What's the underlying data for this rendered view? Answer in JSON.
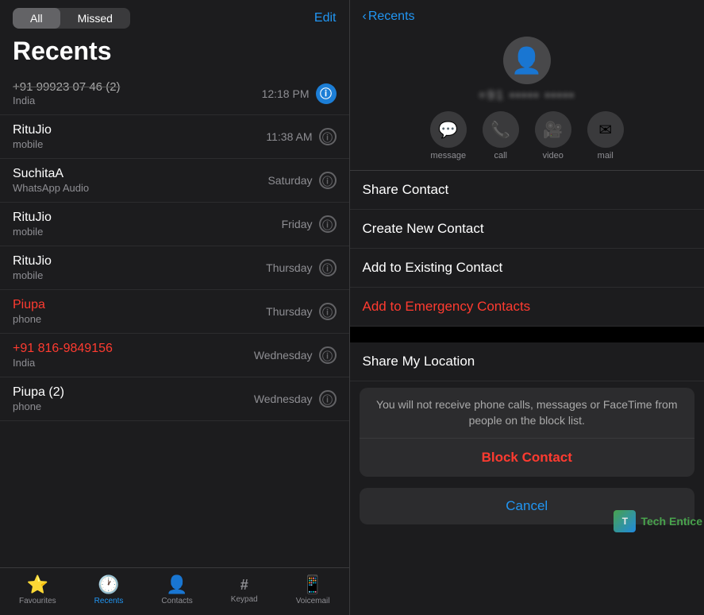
{
  "left": {
    "tabs": {
      "all": "All",
      "missed": "Missed"
    },
    "edit_label": "Edit",
    "title": "Recents",
    "calls": [
      {
        "name": "+91 99923 07 46 (2)",
        "sub": "India",
        "time": "12:18 PM",
        "blurred": true,
        "highlighted": true,
        "info_blue": true
      },
      {
        "name": "RituJio",
        "sub": "mobile",
        "time": "11:38 AM",
        "blurred": false,
        "highlighted": false,
        "info_blue": false
      },
      {
        "name": "SuchitaA",
        "sub": "WhatsApp Audio",
        "time": "Saturday",
        "blurred": false,
        "highlighted": false,
        "info_blue": false
      },
      {
        "name": "RituJio",
        "sub": "mobile",
        "time": "Friday",
        "blurred": false,
        "highlighted": false,
        "info_blue": false
      },
      {
        "name": "RituJio",
        "sub": "mobile",
        "time": "Thursday",
        "blurred": false,
        "highlighted": false,
        "info_blue": false
      },
      {
        "name": "Piupa",
        "sub": "phone",
        "time": "Thursday",
        "blurred": false,
        "highlighted": false,
        "info_blue": false,
        "red_name": true
      },
      {
        "name": "+91 816-9849156",
        "sub": "India",
        "time": "Wednesday",
        "blurred": false,
        "highlighted": false,
        "info_blue": false,
        "red_name": true,
        "red_sub": false
      },
      {
        "name": "Piupa (2)",
        "sub": "phone",
        "time": "Wednesday",
        "blurred": false,
        "highlighted": false,
        "info_blue": false
      }
    ],
    "bottom_tabs": [
      {
        "icon": "⭐",
        "label": "Favourites"
      },
      {
        "icon": "🕐",
        "label": "Recents",
        "active": true
      },
      {
        "icon": "👤",
        "label": "Contacts"
      },
      {
        "icon": "#",
        "label": "Keypad"
      },
      {
        "icon": "📱",
        "label": "Voicemail"
      }
    ]
  },
  "right": {
    "back_label": "Recents",
    "contact_number": "••••••••••••••",
    "action_buttons": [
      {
        "icon": "💬",
        "label": "message"
      },
      {
        "icon": "📞",
        "label": "call"
      },
      {
        "icon": "📷",
        "label": "video"
      },
      {
        "icon": "✉",
        "label": "mail"
      }
    ],
    "menu_items": [
      {
        "label": "Share Contact",
        "red": false
      },
      {
        "label": "Create New Contact",
        "red": false
      },
      {
        "label": "Add to Existing Contact",
        "red": false
      },
      {
        "label": "Add to Emergency Contacts",
        "red": true
      }
    ],
    "share_location_label": "Share My Location",
    "block_desc": "You will not receive phone calls, messages or FaceTime from people on the block list.",
    "block_label": "Block Contact",
    "cancel_label": "Cancel",
    "watermark": "Tech Entice"
  }
}
